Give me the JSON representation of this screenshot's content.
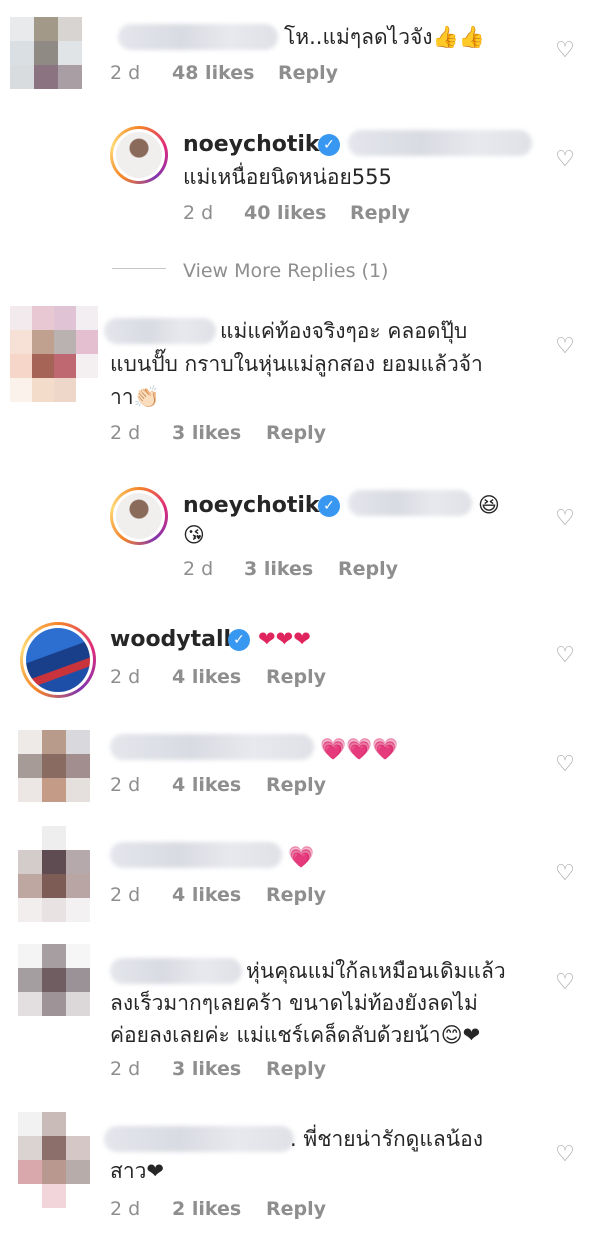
{
  "comments": [
    {
      "text": "โห..แม่ๆลดไวจัง👍👍",
      "time": "2 d",
      "likes": "48 likes",
      "reply": "Reply"
    },
    {
      "username": "noeychotika",
      "text": "แม่เหนื่อยนิดหน่อย555",
      "time": "2 d",
      "likes": "40 likes",
      "reply": "Reply"
    },
    {
      "text_line1": "แม่แค่ท้องจริงๆอะ คลอดปุ๊บ",
      "text_line2": "แบนปั๊บ กราบในหุ่นแม่ลูกสอง ยอมแล้วจ้า",
      "text_line3": "าา👏🏻",
      "time": "2 d",
      "likes": "3 likes",
      "reply": "Reply"
    },
    {
      "username": "noeychotika",
      "text_line1": "😆",
      "text_line2": "😘",
      "time": "2 d",
      "likes": "3 likes",
      "reply": "Reply"
    },
    {
      "username": "woodytalk",
      "text": "❤❤❤",
      "time": "2 d",
      "likes": "4 likes",
      "reply": "Reply"
    },
    {
      "text": "💗💗💗",
      "time": "2 d",
      "likes": "4 likes",
      "reply": "Reply"
    },
    {
      "text": "💗",
      "time": "2 d",
      "likes": "4 likes",
      "reply": "Reply"
    },
    {
      "text_line1": "หุ่นคุณแม่ใก้ลเหมือนเดิมแล้ว",
      "text_line2": "ลงเร็วมากๆเลยคร้า ขนาดไม่ท้องยังลดไม่",
      "text_line3": "ค่อยลงเลยค่ะ แม่แชร์เคล็ดลับด้วยน้า😊❤",
      "time": "2 d",
      "likes": "3 likes",
      "reply": "Reply"
    },
    {
      "text_line1": ". พี่ชายน่ารักดูแลน้อง",
      "text_line2": "สาว❤",
      "time": "2 d",
      "likes": "2 likes",
      "reply": "Reply"
    }
  ],
  "view_more": "View More Replies (1)",
  "icons": {
    "like": "heart-outline-icon",
    "verified": "verified-badge-icon"
  },
  "colors": {
    "meta": "#8e8e8e",
    "text": "#262626",
    "verified": "#3897f0",
    "heart": "#e0245e"
  }
}
